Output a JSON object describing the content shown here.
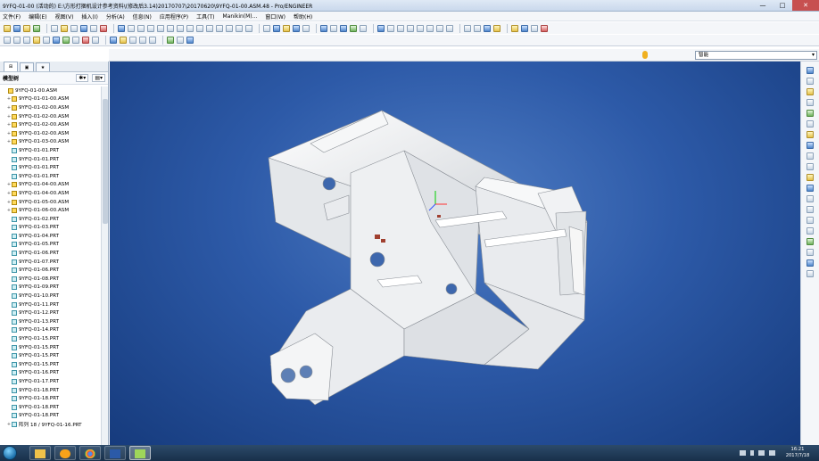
{
  "window": {
    "title": "9YFQ-01-00 (活动的) E:\\方形打捆机设计参考资料\\(修改后3.14)20170707\\20170620\\9YFQ-01-00.ASM.48 - Pro/ENGINEER",
    "min_glyph": "—",
    "max_glyph": "□",
    "close_glyph": "✕"
  },
  "menu": [
    "文件(F)",
    "编辑(E)",
    "视图(V)",
    "插入(I)",
    "分析(A)",
    "信息(N)",
    "应用程序(P)",
    "工具(T)",
    "Manikin(M)...",
    "窗口(W)",
    "帮助(H)"
  ],
  "panel": {
    "tab1": "⊞",
    "tab2": "▣",
    "tab3": "★",
    "title": "模型树",
    "btn_settings": "✱▾",
    "btn_show": "▤▾"
  },
  "tree": [
    {
      "label": "9YFQ-01-00.ASM",
      "type": "asm",
      "level": 0,
      "exp": ""
    },
    {
      "label": "9YFQ-01-01-00.ASM",
      "type": "asm",
      "level": 1,
      "exp": "+"
    },
    {
      "label": "9YFQ-01-02-00.ASM",
      "type": "asm",
      "level": 1,
      "exp": "+"
    },
    {
      "label": "9YFQ-01-02-00.ASM",
      "type": "asm",
      "level": 1,
      "exp": "+"
    },
    {
      "label": "9YFQ-01-02-00.ASM",
      "type": "asm",
      "level": 1,
      "exp": "+"
    },
    {
      "label": "9YFQ-01-02-00.ASM",
      "type": "asm",
      "level": 1,
      "exp": "+"
    },
    {
      "label": "9YFQ-01-03-00.ASM",
      "type": "asm",
      "level": 1,
      "exp": "+"
    },
    {
      "label": "9YFQ-01-01.PRT",
      "type": "prt",
      "level": 1,
      "exp": ""
    },
    {
      "label": "9YFQ-01-01.PRT",
      "type": "prt",
      "level": 1,
      "exp": ""
    },
    {
      "label": "9YFQ-01-01.PRT",
      "type": "prt",
      "level": 1,
      "exp": ""
    },
    {
      "label": "9YFQ-01-01.PRT",
      "type": "prt",
      "level": 1,
      "exp": ""
    },
    {
      "label": "9YFQ-01-04-00.ASM",
      "type": "asm",
      "level": 1,
      "exp": "+"
    },
    {
      "label": "9YFQ-01-04-00.ASM",
      "type": "asm",
      "level": 1,
      "exp": "+"
    },
    {
      "label": "9YFQ-01-05-00.ASM",
      "type": "asm",
      "level": 1,
      "exp": "+"
    },
    {
      "label": "9YFQ-01-06-00.ASM",
      "type": "asm",
      "level": 1,
      "exp": "+"
    },
    {
      "label": "9YFQ-01-02.PRT",
      "type": "prt",
      "level": 1,
      "exp": ""
    },
    {
      "label": "9YFQ-01-03.PRT",
      "type": "prt",
      "level": 1,
      "exp": ""
    },
    {
      "label": "9YFQ-01-04.PRT",
      "type": "prt",
      "level": 1,
      "exp": ""
    },
    {
      "label": "9YFQ-01-05.PRT",
      "type": "prt",
      "level": 1,
      "exp": ""
    },
    {
      "label": "9YFQ-01-06.PRT",
      "type": "prt",
      "level": 1,
      "exp": ""
    },
    {
      "label": "9YFQ-01-07.PRT",
      "type": "prt",
      "level": 1,
      "exp": ""
    },
    {
      "label": "9YFQ-01-06.PRT",
      "type": "prt",
      "level": 1,
      "exp": ""
    },
    {
      "label": "9YFQ-01-08.PRT",
      "type": "prt",
      "level": 1,
      "exp": ""
    },
    {
      "label": "9YFQ-01-09.PRT",
      "type": "prt",
      "level": 1,
      "exp": ""
    },
    {
      "label": "9YFQ-01-10.PRT",
      "type": "prt",
      "level": 1,
      "exp": ""
    },
    {
      "label": "9YFQ-01-11.PRT",
      "type": "prt",
      "level": 1,
      "exp": ""
    },
    {
      "label": "9YFQ-01-12.PRT",
      "type": "prt",
      "level": 1,
      "exp": ""
    },
    {
      "label": "9YFQ-01-13.PRT",
      "type": "prt",
      "level": 1,
      "exp": ""
    },
    {
      "label": "9YFQ-01-14.PRT",
      "type": "prt",
      "level": 1,
      "exp": ""
    },
    {
      "label": "9YFQ-01-15.PRT",
      "type": "prt",
      "level": 1,
      "exp": ""
    },
    {
      "label": "9YFQ-01-15.PRT",
      "type": "prt",
      "level": 1,
      "exp": ""
    },
    {
      "label": "9YFQ-01-15.PRT",
      "type": "prt",
      "level": 1,
      "exp": ""
    },
    {
      "label": "9YFQ-01-15.PRT",
      "type": "prt",
      "level": 1,
      "exp": ""
    },
    {
      "label": "9YFQ-01-16.PRT",
      "type": "prt",
      "level": 1,
      "exp": ""
    },
    {
      "label": "9YFQ-01-17.PRT",
      "type": "prt",
      "level": 1,
      "exp": ""
    },
    {
      "label": "9YFQ-01-18.PRT",
      "type": "prt",
      "level": 1,
      "exp": ""
    },
    {
      "label": "9YFQ-01-18.PRT",
      "type": "prt",
      "level": 1,
      "exp": ""
    },
    {
      "label": "9YFQ-01-18.PRT",
      "type": "prt",
      "level": 1,
      "exp": ""
    },
    {
      "label": "9YFQ-01-18.PRT",
      "type": "prt",
      "level": 1,
      "exp": ""
    },
    {
      "label": "阵列 18 / 9YFQ-01-16.PRT",
      "type": "prt",
      "level": 1,
      "exp": "+"
    }
  ],
  "filter": {
    "value": "智能"
  },
  "taskbar": {
    "time": "16:21",
    "date": "2017/7/18"
  },
  "colors": {
    "viewport_top": "#4f7dc4",
    "viewport_bottom": "#163b7d",
    "model": "#f2f2f2"
  },
  "icons": [
    "windows-start-icon",
    "file-explorer-icon",
    "media-player-icon",
    "chrome-icon",
    "word-icon",
    "proe-icon",
    "network-icon",
    "volume-icon"
  ]
}
